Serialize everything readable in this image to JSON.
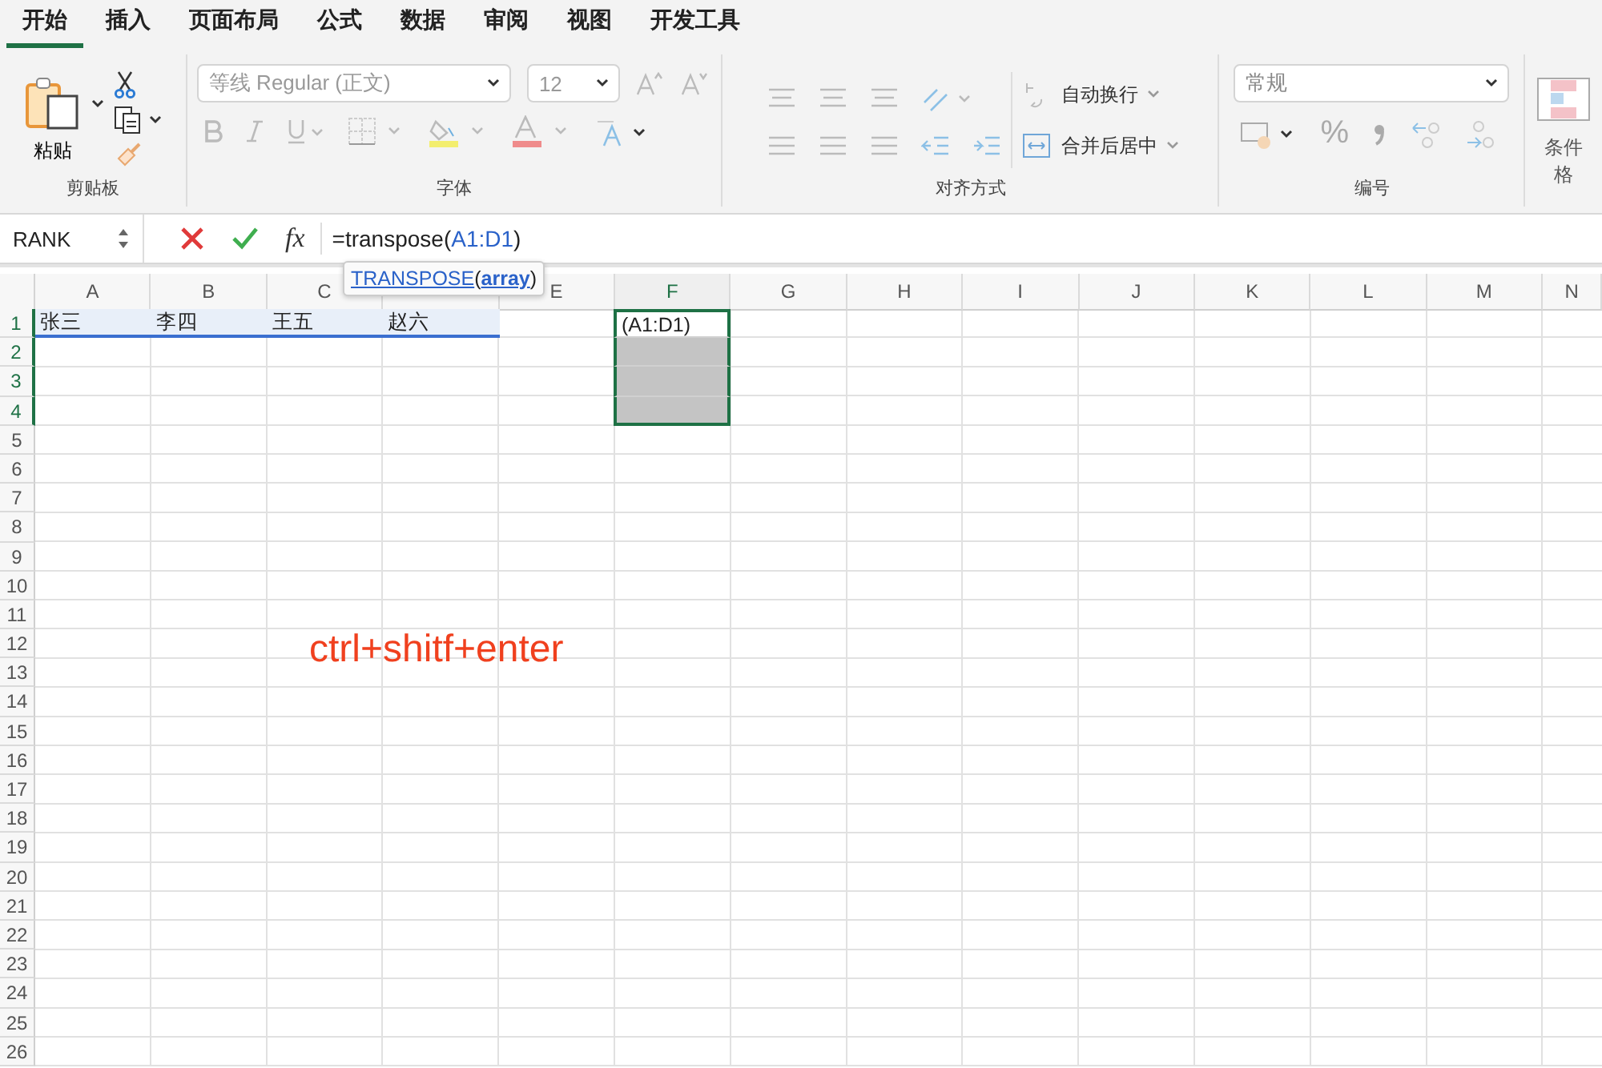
{
  "tabs": [
    {
      "label": "开始",
      "selected": true
    },
    {
      "label": "插入",
      "selected": false
    },
    {
      "label": "页面布局",
      "selected": false
    },
    {
      "label": "公式",
      "selected": false
    },
    {
      "label": "数据",
      "selected": false
    },
    {
      "label": "审阅",
      "selected": false
    },
    {
      "label": "视图",
      "selected": false
    },
    {
      "label": "开发工具",
      "selected": false
    }
  ],
  "ribbon": {
    "clipboard": {
      "paste_label": "粘贴",
      "group_label": "剪贴板"
    },
    "font": {
      "font_name": "等线 Regular (正文)",
      "font_size": "12",
      "group_label": "字体"
    },
    "alignment": {
      "wrap_text": "自动换行",
      "merge_center": "合并后居中",
      "group_label": "对齐方式"
    },
    "number": {
      "format": "常规",
      "percent": "%",
      "group_label": "编号"
    },
    "conditional_format": {
      "label": "条件格"
    }
  },
  "formula_bar": {
    "name_box": "RANK",
    "function_symbol": "fx",
    "formula_prefix": "=transpose(",
    "formula_reference": "A1:D1",
    "formula_suffix": ")"
  },
  "tooltip": {
    "function": "TRANSPOSE",
    "open": "(",
    "argument": "array",
    "close": ")"
  },
  "columns": [
    {
      "label": "A",
      "selected": false
    },
    {
      "label": "B",
      "selected": false
    },
    {
      "label": "C",
      "selected": false
    },
    {},
    {
      "label": "E",
      "selected": false
    },
    {
      "label": "F",
      "selected": true
    },
    {
      "label": "G",
      "selected": false
    },
    {
      "label": "H",
      "selected": false
    },
    {
      "label": "I",
      "selected": false
    },
    {
      "label": "J",
      "selected": false
    },
    {
      "label": "K",
      "selected": false
    },
    {
      "label": "L",
      "selected": false
    },
    {
      "label": "M",
      "selected": false
    },
    {
      "label": "N",
      "selected": false
    }
  ],
  "rows": [
    {
      "label": "1",
      "selected": true,
      "cells": [
        {
          "text": "张三",
          "referenced": true
        },
        {
          "text": "李四",
          "referenced": true
        },
        {
          "text": "王五",
          "referenced": true
        },
        {
          "text": "赵六",
          "referenced": true
        },
        {},
        {
          "text": "(A1:D1)",
          "in_selection": true
        }
      ]
    },
    {
      "label": "2",
      "selected": true,
      "cells": [
        {},
        {},
        {},
        {},
        {},
        {
          "in_selection": true,
          "shaded": true
        }
      ]
    },
    {
      "label": "3",
      "selected": true,
      "cells": [
        {},
        {},
        {},
        {},
        {},
        {
          "in_selection": true,
          "shaded": true
        }
      ]
    },
    {
      "label": "4",
      "selected": true,
      "cells": [
        {},
        {},
        {},
        {},
        {},
        {
          "in_selection": true,
          "shaded": true
        }
      ]
    },
    {
      "label": "5",
      "selected": false
    },
    {
      "label": "6",
      "selected": false
    },
    {
      "label": "7",
      "selected": false
    },
    {
      "label": "8",
      "selected": false
    },
    {
      "label": "9",
      "selected": false
    },
    {
      "label": "10",
      "selected": false
    },
    {
      "label": "11",
      "selected": false
    },
    {
      "label": "12",
      "selected": false
    },
    {
      "label": "13",
      "selected": false
    },
    {
      "label": "14",
      "selected": false
    },
    {
      "label": "15",
      "selected": false
    },
    {
      "label": "16",
      "selected": false
    },
    {
      "label": "17",
      "selected": false
    },
    {
      "label": "18",
      "selected": false
    },
    {
      "label": "19",
      "selected": false
    },
    {
      "label": "20",
      "selected": false
    },
    {
      "label": "21",
      "selected": false
    },
    {
      "label": "22",
      "selected": false
    },
    {
      "label": "23",
      "selected": false
    },
    {
      "label": "24",
      "selected": false
    },
    {
      "label": "25",
      "selected": false
    },
    {
      "label": "26",
      "selected": false
    }
  ],
  "annotation": "ctrl+shitf+enter"
}
